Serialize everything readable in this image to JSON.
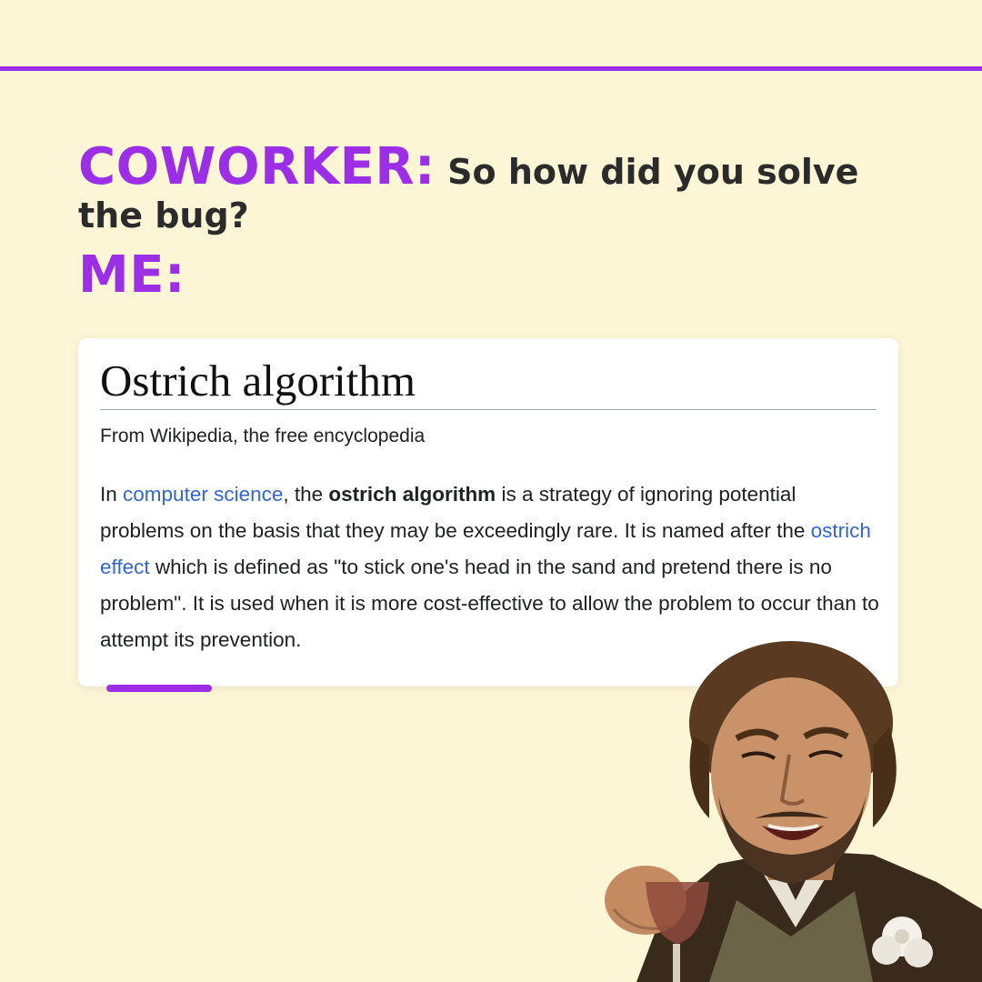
{
  "colors": {
    "background": "#fcf5d6",
    "accent": "#9b2ee6",
    "link": "#3366cc",
    "text": "#2b2b2b"
  },
  "dialogue": {
    "coworker_label": "COWORKER:",
    "coworker_question": "So how did you solve the bug?",
    "me_label": "ME:"
  },
  "article": {
    "title": "Ostrich algorithm",
    "tagline": "From Wikipedia, the free encyclopedia",
    "body": {
      "s1": "In ",
      "link1": "computer science",
      "s2": ", the ",
      "bold1": "ostrich algorithm",
      "s3": " is a strategy of ignoring potential problems on the basis that they may be exceedingly rare. It is named after the ",
      "link2": "ostrich effect",
      "s4": " which is defined as \"to stick one's head in the sand and pretend there is no problem\". It is used when it is more cost-effective to allow the problem to occur than to attempt its prevention."
    }
  },
  "meme_image": {
    "icon": "laughing-man-with-drink-photo"
  }
}
